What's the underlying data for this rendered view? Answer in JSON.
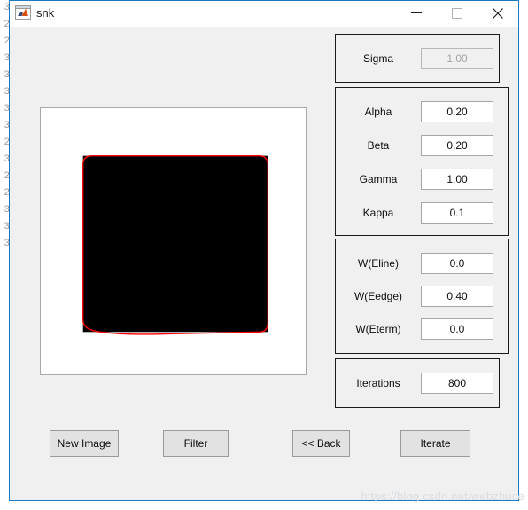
{
  "background": {
    "line_numbers": [
      "3",
      "2",
      "2",
      "3",
      "3",
      "3",
      "3",
      "3",
      "2",
      "3",
      "2",
      "2",
      "3",
      "3",
      "3"
    ]
  },
  "window": {
    "title": "snk",
    "icon": "matlab-icon",
    "controls": {
      "minimize": "minimize-icon",
      "maximize": "maximize-icon",
      "close": "close-icon"
    }
  },
  "image_axes": {
    "name": "snake-contour-image",
    "background_color": "#ffffff",
    "object_color": "#000000",
    "contour_color": "#ff0000"
  },
  "panels": {
    "sigma": {
      "fields": [
        {
          "label": "Sigma",
          "value": "1.00",
          "disabled": true
        }
      ]
    },
    "weights": {
      "fields": [
        {
          "label": "Alpha",
          "value": "0.20",
          "disabled": false
        },
        {
          "label": "Beta",
          "value": "0.20",
          "disabled": false
        },
        {
          "label": "Gamma",
          "value": "1.00",
          "disabled": false
        },
        {
          "label": "Kappa",
          "value": "0.1",
          "disabled": false
        }
      ]
    },
    "energy": {
      "fields": [
        {
          "label": "W(Eline)",
          "value": "0.0",
          "disabled": false
        },
        {
          "label": "W(Eedge)",
          "value": "0.40",
          "disabled": false
        },
        {
          "label": "W(Eterm)",
          "value": "0.0",
          "disabled": false
        }
      ]
    },
    "iterations": {
      "fields": [
        {
          "label": "Iterations",
          "value": "800",
          "disabled": false
        }
      ]
    }
  },
  "buttons": {
    "new_image": "New Image",
    "filter": "Filter",
    "back": "<< Back",
    "iterate": "Iterate"
  },
  "watermark": "https://blog.csdn.net/webzhuce",
  "colors": {
    "window_border": "#1a7ac4",
    "panel_bg": "#f0f0f0",
    "button_bg": "#e2e2e2",
    "contour": "#ff0000"
  }
}
